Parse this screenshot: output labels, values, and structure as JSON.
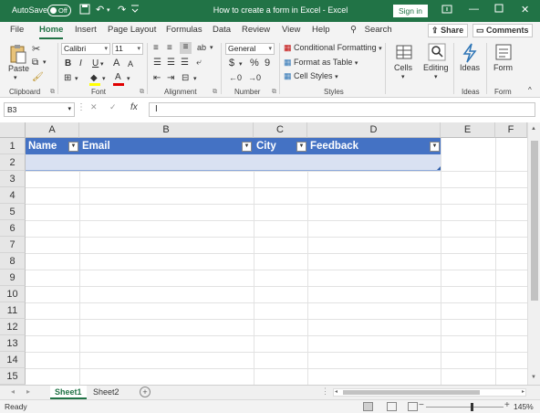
{
  "titlebar": {
    "autosave_label": "AutoSave",
    "autosave_state": "Off",
    "doc_title": "How to create a form in Excel  -  Excel",
    "signin_label": "Sign in"
  },
  "menu": {
    "items": [
      "File",
      "Home",
      "Insert",
      "Page Layout",
      "Formulas",
      "Data",
      "Review",
      "View",
      "Help"
    ],
    "active": "Home",
    "search_label": "Search",
    "share_label": "Share",
    "comments_label": "Comments"
  },
  "ribbon": {
    "clipboard": {
      "paste_label": "Paste",
      "group_label": "Clipboard"
    },
    "font": {
      "font_name": "Calibri",
      "font_size": "11",
      "group_label": "Font",
      "bold": "B",
      "italic": "I",
      "underline": "U",
      "grow": "A",
      "shrink": "A",
      "color_a": "A"
    },
    "alignment": {
      "group_label": "Alignment"
    },
    "number": {
      "format": "General",
      "currency": "$",
      "percent": "%",
      "comma": "9",
      "group_label": "Number"
    },
    "styles": {
      "conditional": "Conditional Formatting",
      "format_table": "Format as Table",
      "cell_styles": "Cell Styles",
      "group_label": "Styles"
    },
    "cells": {
      "label": "Cells"
    },
    "editing": {
      "label": "Editing"
    },
    "ideas": {
      "label": "Ideas",
      "group_label": "Ideas"
    },
    "form": {
      "label": "Form",
      "group_label": "Form"
    }
  },
  "formulabar": {
    "namebox": "B3",
    "fx": "fx",
    "cancel": "✕",
    "enter": "✓",
    "content": ""
  },
  "sheet": {
    "columns": [
      "A",
      "B",
      "C",
      "D",
      "E",
      "F"
    ],
    "rows": [
      "1",
      "2",
      "3",
      "4",
      "5",
      "6",
      "7",
      "8",
      "9",
      "10",
      "11",
      "12",
      "13",
      "14",
      "15"
    ],
    "table_headers": [
      "Name",
      "Email",
      "City",
      "Feedback"
    ],
    "header_color": "#4472c4",
    "band_color": "#d9e1f2"
  },
  "tabs": {
    "sheets": [
      "Sheet1",
      "Sheet2"
    ],
    "active": "Sheet1",
    "add_label": "+"
  },
  "status": {
    "ready": "Ready",
    "zoom": "145%",
    "zoom_minus": "−",
    "zoom_plus": "+"
  }
}
